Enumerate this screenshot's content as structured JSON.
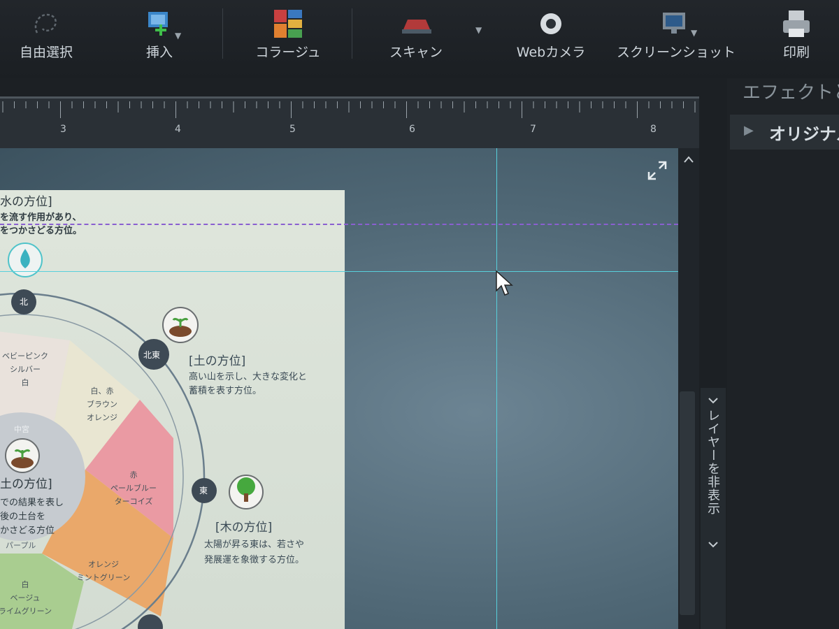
{
  "toolbar": {
    "items": [
      {
        "label": "自由選択",
        "icon": "lasso-icon"
      },
      {
        "label": "挿入",
        "icon": "insert-icon"
      },
      {
        "label": "コラージュ",
        "icon": "collage-icon"
      },
      {
        "label": "スキャン",
        "icon": "scanner-icon"
      },
      {
        "label": "Webカメラ",
        "icon": "webcam-icon"
      },
      {
        "label": "スクリーンショット",
        "icon": "screenshot-icon"
      },
      {
        "label": "印刷",
        "icon": "printer-icon"
      }
    ]
  },
  "ruler": {
    "numbers": [
      "3",
      "4",
      "5",
      "6",
      "7",
      "8"
    ]
  },
  "right_panel": {
    "heading": "エフェクトと",
    "row_label": "オリジナル"
  },
  "layer_toggle": "レイヤーを非表示",
  "document": {
    "water_heading": "水の方位]",
    "water_desc_1": "を流す作用があり、",
    "water_desc_2": "をつかさどる方位。",
    "earth_ne_heading": "[土の方位]",
    "earth_ne_desc_1": "高い山を示し、大きな変化と",
    "earth_ne_desc_2": "蓄積を表す方位。",
    "wood_heading": "[木の方位]",
    "wood_desc_1": "太陽が昇る東は、若さや",
    "wood_desc_2": "発展運を象徴する方位。",
    "dir_north": "北",
    "dir_northeast": "北東",
    "dir_east": "東",
    "center_top": "中宮",
    "center_heading": "土の方位]",
    "center_desc_1": "での結果を表し",
    "center_desc_2": "後の土台を",
    "center_desc_3": "かさどる方位",
    "center_color": "パープル",
    "wedge_n": [
      "ベビーピンク",
      "シルバー",
      "白"
    ],
    "wedge_ne": [
      "白、赤",
      "ブラウン",
      "オレンジ"
    ],
    "wedge_e": [
      "赤",
      "ペールブルー",
      "ターコイズ"
    ],
    "wedge_se": [
      "オレンジ",
      "ミントグリーン"
    ],
    "wedge_s": [
      "白",
      "ベージュ",
      "ライムグリーン"
    ]
  },
  "colors": {
    "guide": "#58d0dc",
    "guide_purple": "#8a5fd0",
    "wedge_pink": "#ea9aa3",
    "wedge_orange": "#eaa86a",
    "wedge_green": "#a9cd90",
    "wedge_light": "#e9e6d2"
  }
}
